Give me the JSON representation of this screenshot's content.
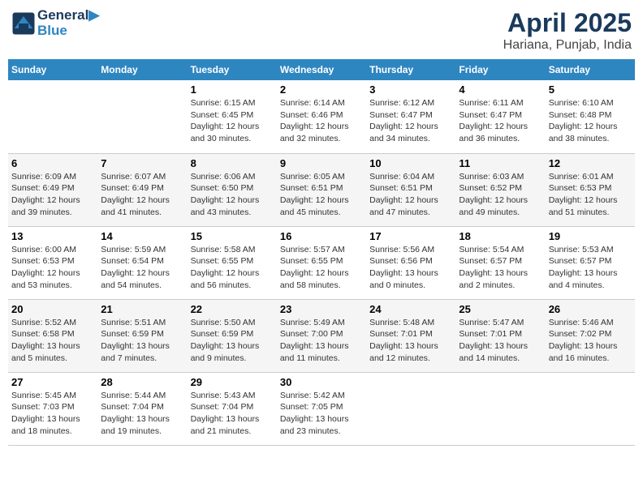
{
  "logo": {
    "line1": "General",
    "line2": "Blue"
  },
  "title": "April 2025",
  "subtitle": "Hariana, Punjab, India",
  "weekdays": [
    "Sunday",
    "Monday",
    "Tuesday",
    "Wednesday",
    "Thursday",
    "Friday",
    "Saturday"
  ],
  "weeks": [
    [
      {
        "day": "",
        "info": ""
      },
      {
        "day": "",
        "info": ""
      },
      {
        "day": "1",
        "info": "Sunrise: 6:15 AM\nSunset: 6:45 PM\nDaylight: 12 hours\nand 30 minutes."
      },
      {
        "day": "2",
        "info": "Sunrise: 6:14 AM\nSunset: 6:46 PM\nDaylight: 12 hours\nand 32 minutes."
      },
      {
        "day": "3",
        "info": "Sunrise: 6:12 AM\nSunset: 6:47 PM\nDaylight: 12 hours\nand 34 minutes."
      },
      {
        "day": "4",
        "info": "Sunrise: 6:11 AM\nSunset: 6:47 PM\nDaylight: 12 hours\nand 36 minutes."
      },
      {
        "day": "5",
        "info": "Sunrise: 6:10 AM\nSunset: 6:48 PM\nDaylight: 12 hours\nand 38 minutes."
      }
    ],
    [
      {
        "day": "6",
        "info": "Sunrise: 6:09 AM\nSunset: 6:49 PM\nDaylight: 12 hours\nand 39 minutes."
      },
      {
        "day": "7",
        "info": "Sunrise: 6:07 AM\nSunset: 6:49 PM\nDaylight: 12 hours\nand 41 minutes."
      },
      {
        "day": "8",
        "info": "Sunrise: 6:06 AM\nSunset: 6:50 PM\nDaylight: 12 hours\nand 43 minutes."
      },
      {
        "day": "9",
        "info": "Sunrise: 6:05 AM\nSunset: 6:51 PM\nDaylight: 12 hours\nand 45 minutes."
      },
      {
        "day": "10",
        "info": "Sunrise: 6:04 AM\nSunset: 6:51 PM\nDaylight: 12 hours\nand 47 minutes."
      },
      {
        "day": "11",
        "info": "Sunrise: 6:03 AM\nSunset: 6:52 PM\nDaylight: 12 hours\nand 49 minutes."
      },
      {
        "day": "12",
        "info": "Sunrise: 6:01 AM\nSunset: 6:53 PM\nDaylight: 12 hours\nand 51 minutes."
      }
    ],
    [
      {
        "day": "13",
        "info": "Sunrise: 6:00 AM\nSunset: 6:53 PM\nDaylight: 12 hours\nand 53 minutes."
      },
      {
        "day": "14",
        "info": "Sunrise: 5:59 AM\nSunset: 6:54 PM\nDaylight: 12 hours\nand 54 minutes."
      },
      {
        "day": "15",
        "info": "Sunrise: 5:58 AM\nSunset: 6:55 PM\nDaylight: 12 hours\nand 56 minutes."
      },
      {
        "day": "16",
        "info": "Sunrise: 5:57 AM\nSunset: 6:55 PM\nDaylight: 12 hours\nand 58 minutes."
      },
      {
        "day": "17",
        "info": "Sunrise: 5:56 AM\nSunset: 6:56 PM\nDaylight: 13 hours\nand 0 minutes."
      },
      {
        "day": "18",
        "info": "Sunrise: 5:54 AM\nSunset: 6:57 PM\nDaylight: 13 hours\nand 2 minutes."
      },
      {
        "day": "19",
        "info": "Sunrise: 5:53 AM\nSunset: 6:57 PM\nDaylight: 13 hours\nand 4 minutes."
      }
    ],
    [
      {
        "day": "20",
        "info": "Sunrise: 5:52 AM\nSunset: 6:58 PM\nDaylight: 13 hours\nand 5 minutes."
      },
      {
        "day": "21",
        "info": "Sunrise: 5:51 AM\nSunset: 6:59 PM\nDaylight: 13 hours\nand 7 minutes."
      },
      {
        "day": "22",
        "info": "Sunrise: 5:50 AM\nSunset: 6:59 PM\nDaylight: 13 hours\nand 9 minutes."
      },
      {
        "day": "23",
        "info": "Sunrise: 5:49 AM\nSunset: 7:00 PM\nDaylight: 13 hours\nand 11 minutes."
      },
      {
        "day": "24",
        "info": "Sunrise: 5:48 AM\nSunset: 7:01 PM\nDaylight: 13 hours\nand 12 minutes."
      },
      {
        "day": "25",
        "info": "Sunrise: 5:47 AM\nSunset: 7:01 PM\nDaylight: 13 hours\nand 14 minutes."
      },
      {
        "day": "26",
        "info": "Sunrise: 5:46 AM\nSunset: 7:02 PM\nDaylight: 13 hours\nand 16 minutes."
      }
    ],
    [
      {
        "day": "27",
        "info": "Sunrise: 5:45 AM\nSunset: 7:03 PM\nDaylight: 13 hours\nand 18 minutes."
      },
      {
        "day": "28",
        "info": "Sunrise: 5:44 AM\nSunset: 7:04 PM\nDaylight: 13 hours\nand 19 minutes."
      },
      {
        "day": "29",
        "info": "Sunrise: 5:43 AM\nSunset: 7:04 PM\nDaylight: 13 hours\nand 21 minutes."
      },
      {
        "day": "30",
        "info": "Sunrise: 5:42 AM\nSunset: 7:05 PM\nDaylight: 13 hours\nand 23 minutes."
      },
      {
        "day": "",
        "info": ""
      },
      {
        "day": "",
        "info": ""
      },
      {
        "day": "",
        "info": ""
      }
    ]
  ]
}
